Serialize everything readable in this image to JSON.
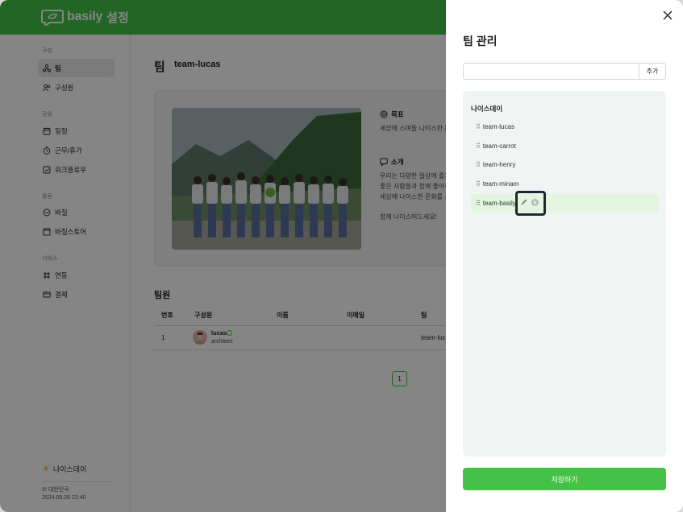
{
  "app": {
    "logo_text": "basily",
    "logo_sub": "설정",
    "brand_color": "#44c146"
  },
  "sidebar": {
    "sections": [
      {
        "title": "구성",
        "items": [
          {
            "label": "팀",
            "icon": "team-icon",
            "active": true
          },
          {
            "label": "구성원",
            "icon": "members-icon"
          }
        ]
      },
      {
        "title": "공유",
        "items": [
          {
            "label": "일정",
            "icon": "calendar-icon"
          },
          {
            "label": "근무/휴가",
            "icon": "clock-icon"
          },
          {
            "label": "워크플로우",
            "icon": "workflow-icon"
          }
        ]
      },
      {
        "title": "활동",
        "items": [
          {
            "label": "바질",
            "icon": "basil-icon"
          },
          {
            "label": "바질스토어",
            "icon": "store-icon"
          }
        ]
      },
      {
        "title": "서비스",
        "items": [
          {
            "label": "연동",
            "icon": "integration-icon"
          },
          {
            "label": "결제",
            "icon": "card-icon"
          }
        ]
      }
    ],
    "org_name": "나이스데이",
    "locale": "대한민국",
    "datetime": "2024.09.26 22:40"
  },
  "main": {
    "title": "팀",
    "team_name": "team-lucas",
    "goal_label": "목표",
    "goal_text": "세상에 스며들 나이스한 문",
    "intro_label": "소개",
    "intro_text": "우리는 다양한 일상에 즐거\n좋은 사람들과 함께 좋아히\n세상에 나이스한 문화를 스",
    "intro_foot": "함께 나이스머드세요!",
    "members_title": "팀원",
    "columns": [
      "번호",
      "구성원",
      "이름",
      "이메일",
      "팀"
    ],
    "rows": [
      {
        "no": "1",
        "member": "lucas",
        "role": "architect",
        "team": "team-luc"
      }
    ],
    "page": "1"
  },
  "drawer": {
    "title": "팀 관리",
    "input_value": "",
    "input_placeholder": "",
    "add_label": "추가",
    "org_name": "나이스데이",
    "teams": [
      "team-lucas",
      "team-carrot",
      "team-henry",
      "team-minam",
      "team-basily"
    ],
    "active_team_index": 4,
    "save_label": "저장하기"
  }
}
